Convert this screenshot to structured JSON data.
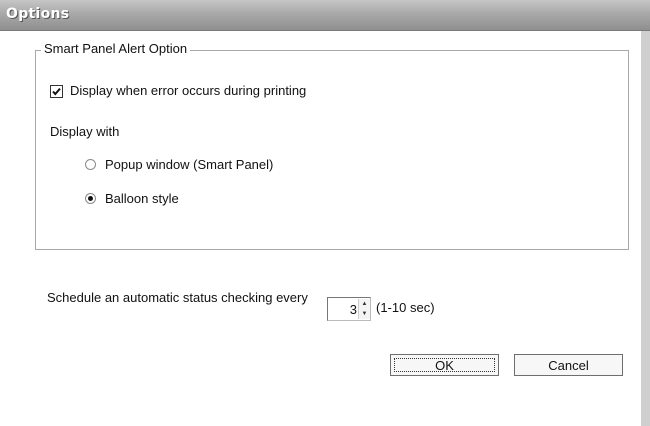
{
  "window": {
    "title": "Options"
  },
  "alert_group": {
    "label": "Smart Panel Alert Option",
    "display_on_error": {
      "label": "Display when error occurs during printing",
      "checked": true
    },
    "display_with": {
      "label": "Display with",
      "options": [
        {
          "label": "Popup window (Smart Panel)",
          "selected": false
        },
        {
          "label": "Balloon style",
          "selected": true
        }
      ]
    }
  },
  "schedule": {
    "label": "Schedule an automatic status checking every",
    "value": "3",
    "range": "(1-10 sec)"
  },
  "buttons": {
    "ok": "OK",
    "cancel": "Cancel"
  }
}
